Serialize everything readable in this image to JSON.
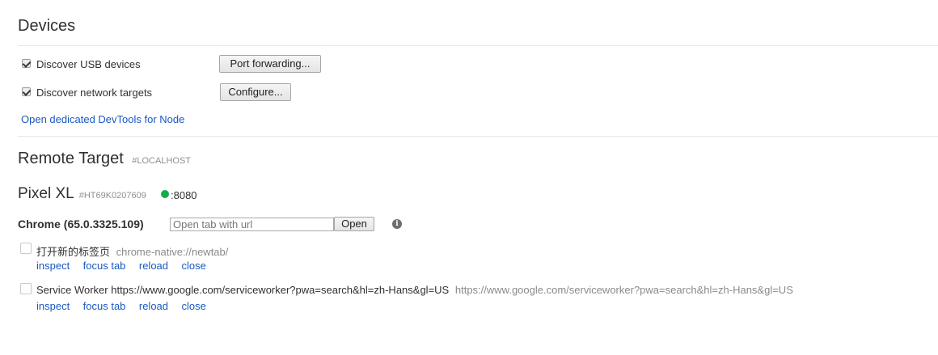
{
  "devices": {
    "title": "Devices",
    "usb_label": "Discover USB devices",
    "port_forwarding_label": "Port forwarding...",
    "network_label": "Discover network targets",
    "configure_label": "Configure...",
    "node_link": "Open dedicated DevTools for Node"
  },
  "remote": {
    "title": "Remote Target",
    "subtitle": "#LOCALHOST"
  },
  "device": {
    "name": "Pixel XL",
    "serial": "#HT69K0207609",
    "port": ":8080",
    "status_color": "#13ad4c"
  },
  "browser": {
    "name": "Chrome (65.0.3325.109)",
    "url_placeholder": "Open tab with url",
    "open_label": "Open",
    "info_glyph": "i"
  },
  "targets": [
    {
      "title": "打开新的标签页",
      "url": "chrome-native://newtab/",
      "actions": [
        "inspect",
        "focus tab",
        "reload",
        "close"
      ]
    },
    {
      "title": "Service Worker https://www.google.com/serviceworker?pwa=search&hl=zh-Hans&gl=US",
      "url": "https://www.google.com/serviceworker?pwa=search&hl=zh-Hans&gl=US",
      "actions": [
        "inspect",
        "focus tab",
        "reload",
        "close"
      ]
    }
  ]
}
